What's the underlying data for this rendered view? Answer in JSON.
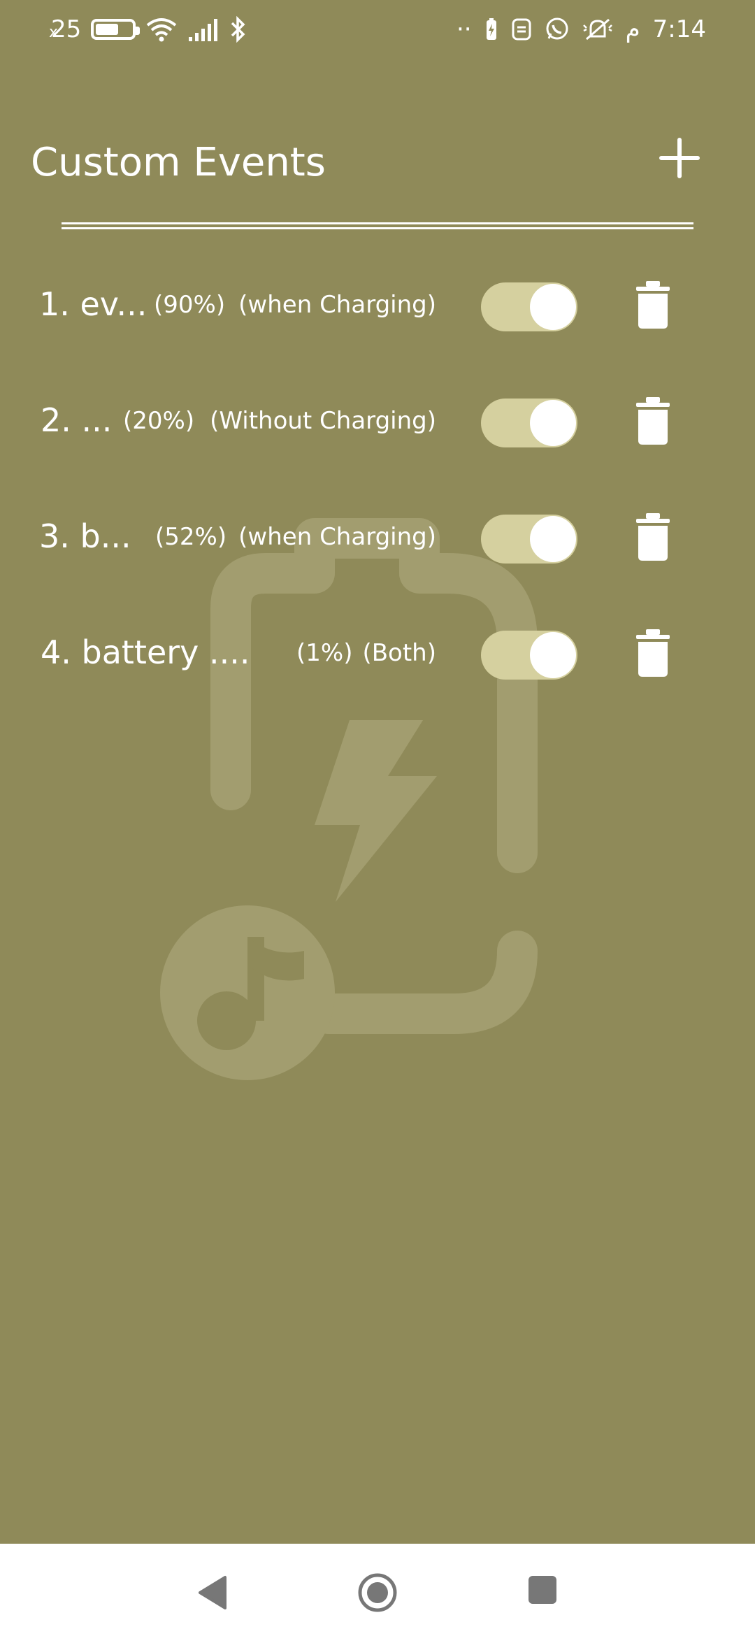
{
  "status_bar": {
    "speed_prefix": "x",
    "speed_value": "25",
    "dots": "··",
    "ampm": "م",
    "time": "7:14"
  },
  "header": {
    "title": "Custom Events"
  },
  "events": [
    {
      "name": "1. ev...",
      "percent": "(90%)",
      "mode": "(when Charging)",
      "enabled": true
    },
    {
      "name": "2. ...",
      "percent": "(20%)",
      "mode": "(Without Charging)",
      "enabled": true
    },
    {
      "name": "3. b...",
      "percent": "(52%)",
      "mode": "(when Charging)",
      "enabled": true
    },
    {
      "name": "4. battery ....",
      "percent": "(1%)",
      "mode": "(Both)",
      "enabled": true
    }
  ],
  "colors": {
    "background": "#8f8a59",
    "toggle_track": "#d5d09f",
    "watermark": "#a29d6f"
  },
  "icons": {
    "add": "plus-icon",
    "delete": "trash-icon",
    "watermark": "battery-music-icon"
  }
}
